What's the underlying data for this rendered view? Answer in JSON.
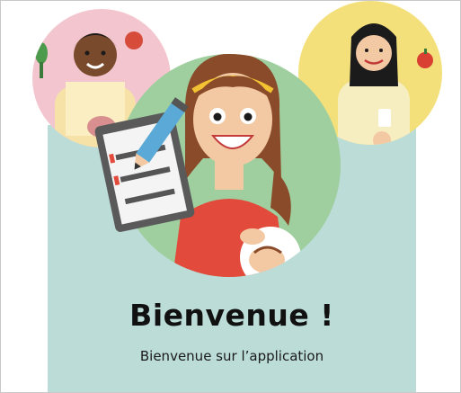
{
  "welcome": {
    "title": "Bienvenue !",
    "subtitle": "Bienvenue sur l’application"
  },
  "illustration": {
    "icons": [
      "mother-left-icon",
      "mother-center-icon",
      "mother-right-icon",
      "clipboard-icon",
      "pencil-icon",
      "baby-icon"
    ],
    "colors": {
      "panel": "#bcdcd8",
      "circle_left": "#f3c6cf",
      "circle_center": "#9fcf9f",
      "circle_right": "#f4e07a",
      "dress": "#e24a3b",
      "hair": "#8a4b2a"
    }
  }
}
